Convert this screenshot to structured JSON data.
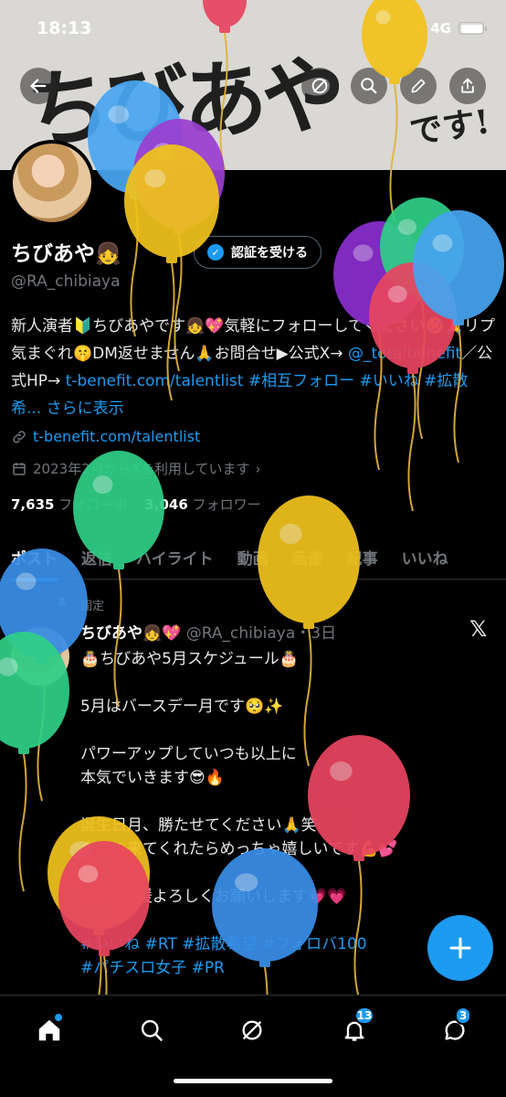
{
  "status_bar": {
    "time": "18:13",
    "network": "4G"
  },
  "banner": {
    "calligraphy": "ちびあやりです!",
    "calligraphy_main": "ちびあや",
    "calligraphy_tail": "です!"
  },
  "profile": {
    "display_name": "ちびあや👧",
    "verify_label": "認証を受ける",
    "handle": "@RA_chibiaya",
    "bio_1": "新人演者🔰ちびあやです👧💖気軽にフォローし",
    "bio_1b": "てください🤣🙏リプ気まぐれ🤫DM返せません🙏お問合せ▶公式X→ ",
    "bio_link1": "@_totalbenefit",
    "bio_2": "／公式HP→ ",
    "bio_link2": "t-benefit.com/talentlist",
    "bio_tags": " #相互フォロー #いいね #拡散希...",
    "bio_more": "さらに表示",
    "website": "t-benefit.com/talentlist",
    "joined": "2023年2月からXを利用しています",
    "following_count": "7,635",
    "following_label": "フォロー中",
    "followers_count": "3,046",
    "followers_label": "フォロワー"
  },
  "tabs": [
    "ポスト",
    "返信",
    "ハイライト",
    "動画",
    "画像",
    "記事",
    "いいね"
  ],
  "post": {
    "pinned_label": "固定",
    "author": "ちびあや👧💖",
    "handle_time": "@RA_chibiaya・3日",
    "body": "🎂ちびあや5月スケジュール🎂\n\n5月はバースデー月です🥺✨\n\nパワーアップしていつも以上に\n本気でいきます😎🔥\n\n誕生日月、勝たせてください🙏笑\n会いに来てくれたらめっちゃ嬉しいです💪💕\n\n5月も応援よろしくお願いします💗💗",
    "hashtags": "#いいね #RT #拡散希望 #フォロバ100\n#パチスロ女子 #PR"
  },
  "nav": {
    "notifications_badge": "13",
    "messages_badge": "3"
  },
  "icons": {
    "back": "back-arrow-icon",
    "grok": "grok-icon",
    "search": "search-icon",
    "edit": "pencil-icon",
    "share": "share-icon",
    "link": "link-icon",
    "calendar": "calendar-icon",
    "pin": "pin-icon",
    "x": "x-logo-icon",
    "home": "home-icon",
    "notifications": "bell-icon",
    "messages": "message-icon",
    "compose": "plus-icon"
  },
  "colors": {
    "accent": "#1d9bf0",
    "background": "#000000",
    "muted": "#71767b"
  }
}
